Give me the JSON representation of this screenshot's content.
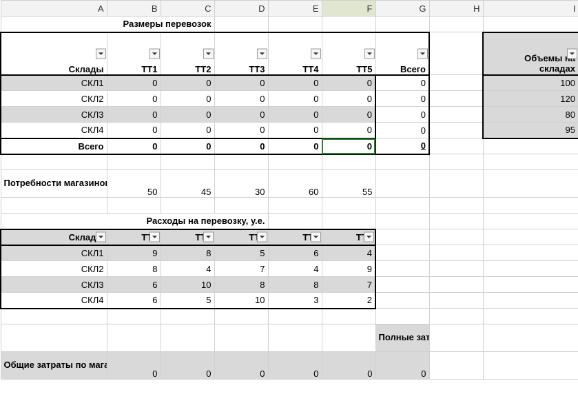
{
  "columns": [
    "A",
    "B",
    "C",
    "D",
    "E",
    "F",
    "G",
    "H",
    "I"
  ],
  "selectedCol": "F",
  "hdr": {
    "title1": "Размеры перевозок",
    "warehouses": "Склады",
    "tt": [
      "ТТ1",
      "ТТ2",
      "ТТ3",
      "ТТ4",
      "ТТ5"
    ],
    "total": "Всего",
    "volumes_line1": "Объемы на",
    "volumes_line2": "складах",
    "needs": "Потребности магазинов",
    "title2": "Расходы на перевозку, у.е.",
    "fullcosts": "Полные затраты",
    "storecosts": "Общие затраты по магазинам"
  },
  "skl": [
    "СКЛ1",
    "СКЛ2",
    "СКЛ3",
    "СКЛ4"
  ],
  "sizes": {
    "rows": [
      [
        0,
        0,
        0,
        0,
        0,
        0
      ],
      [
        0,
        0,
        0,
        0,
        0,
        0
      ],
      [
        0,
        0,
        0,
        0,
        0,
        0
      ],
      [
        0,
        0,
        0,
        0,
        0,
        0
      ]
    ],
    "totalRow": [
      0,
      0,
      0,
      0,
      0,
      0
    ]
  },
  "volumes": [
    100,
    120,
    80,
    95
  ],
  "needs": [
    50,
    45,
    30,
    60,
    55
  ],
  "costs": {
    "rows": [
      [
        9,
        8,
        5,
        6,
        4
      ],
      [
        8,
        4,
        7,
        4,
        9
      ],
      [
        6,
        10,
        8,
        8,
        7
      ],
      [
        6,
        5,
        10,
        3,
        2
      ]
    ]
  },
  "storecosts": [
    0,
    0,
    0,
    0,
    0,
    0
  ]
}
